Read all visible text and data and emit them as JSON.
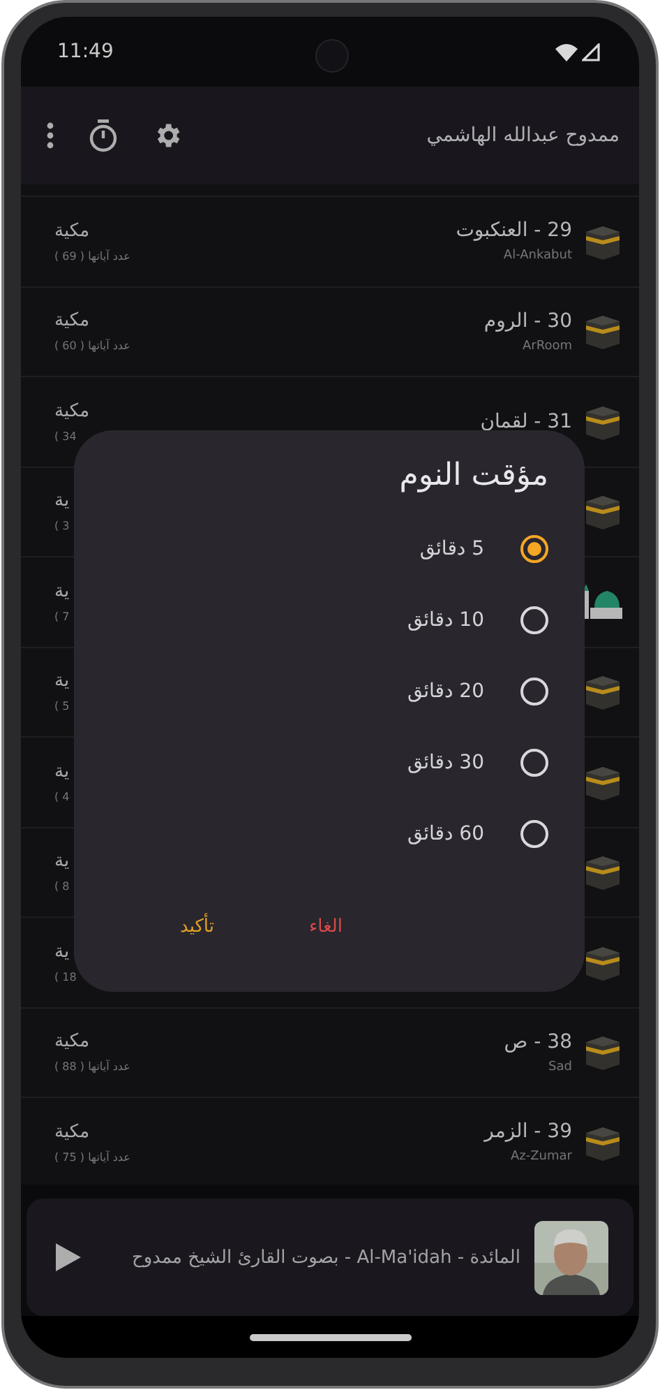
{
  "status_bar": {
    "time": "11:49"
  },
  "app_bar": {
    "title": "ممدوح عبدالله الهاشمي"
  },
  "surahs": [
    {
      "kind": "kaaba",
      "title": "29 - العنكبوت",
      "subtitle": "Al-Ankabut",
      "place": "مكية",
      "verses": "عدد آياتها ( 69 )"
    },
    {
      "kind": "kaaba",
      "title": "30 - الروم",
      "subtitle": "ArRoom",
      "place": "مكية",
      "verses": "عدد آياتها ( 60 )"
    },
    {
      "kind": "kaaba",
      "title": "31 - لقمان",
      "place": "مكية",
      "verses": "( 34"
    },
    {
      "kind": "kaaba",
      "place": "ية",
      "verses": "( 3"
    },
    {
      "kind": "mosque",
      "place": "ية",
      "verses": "( 7"
    },
    {
      "kind": "kaaba",
      "place": "ية",
      "verses": "( 5"
    },
    {
      "kind": "kaaba",
      "place": "ية",
      "verses": "( 4"
    },
    {
      "kind": "kaaba",
      "place": "ية",
      "verses": "( 8"
    },
    {
      "kind": "kaaba",
      "place": "ية",
      "verses": "( 18"
    },
    {
      "kind": "kaaba",
      "title": "38 - ص",
      "subtitle": "Sad",
      "place": "مكية",
      "verses": "عدد آياتها ( 88 )"
    },
    {
      "kind": "kaaba",
      "title": "39 - الزمر",
      "subtitle": "Az-Zumar",
      "place": "مكية",
      "verses": "عدد آياتها ( 75 )"
    }
  ],
  "dialog": {
    "title": "مؤقت النوم",
    "options": [
      {
        "label": "5 دقائق",
        "selected": true
      },
      {
        "label": "10 دقائق",
        "selected": false
      },
      {
        "label": "20 دقائق",
        "selected": false
      },
      {
        "label": "30 دقائق",
        "selected": false
      },
      {
        "label": "60 دقائق",
        "selected": false
      }
    ],
    "buttons": [
      {
        "kind": "cancel",
        "label": "الغاء"
      },
      {
        "kind": "confirm",
        "label": "تأكيد"
      }
    ]
  },
  "player": {
    "text": "المائدة  -  Al-Ma'idah  -  بصوت القارئ الشيخ ممدوح"
  }
}
